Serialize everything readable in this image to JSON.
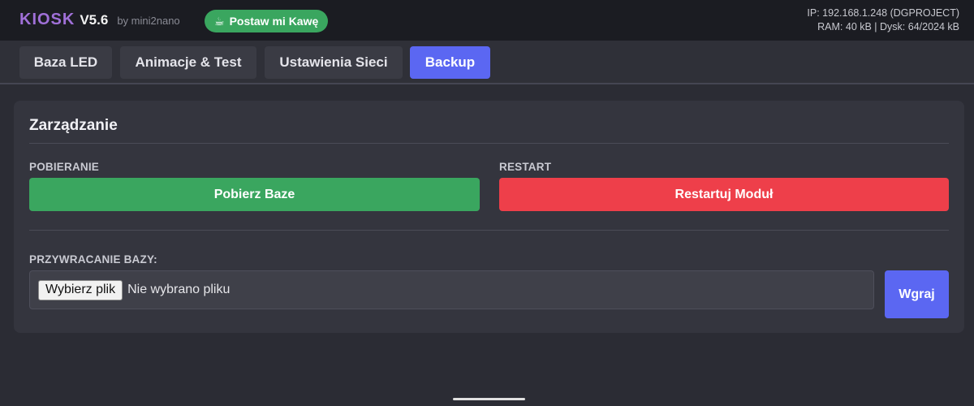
{
  "header": {
    "brand_name": "KIOSK",
    "version": "V5.6",
    "author": "by mini2nano",
    "coffee_button": "Postaw mi Kawę",
    "coffee_icon": "☕",
    "ip_line": "IP: 192.168.1.248 (DGPROJECT)",
    "resources_line": "RAM: 40 kB | Dysk: 64/2024 kB"
  },
  "tabs": [
    {
      "label": "Baza LED",
      "active": false
    },
    {
      "label": "Animacje & Test",
      "active": false
    },
    {
      "label": "Ustawienia Sieci",
      "active": false
    },
    {
      "label": "Backup",
      "active": true
    }
  ],
  "panel": {
    "title": "Zarządzanie",
    "download_label": "POBIERANIE",
    "download_button": "Pobierz Baze",
    "restart_label": "RESTART",
    "restart_button": "Restartuj Moduł",
    "restore_label": "PRZYWRACANIE BAZY:",
    "file_button": "Wybierz plik",
    "file_status": "Nie wybrano pliku",
    "upload_button": "Wgraj"
  },
  "colors": {
    "accent": "#5b67f2",
    "success": "#3aa65f",
    "danger": "#ee3f4a",
    "brand": "#a070d8"
  }
}
